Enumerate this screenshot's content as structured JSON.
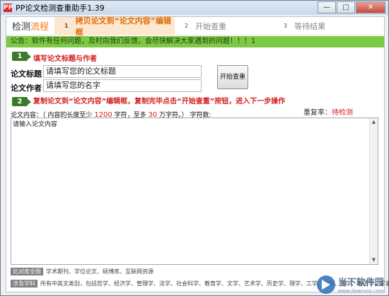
{
  "window": {
    "title": "PP论文检测查重助手1.39",
    "icon": "PP",
    "buttons": [
      "—",
      "□",
      "✕"
    ]
  },
  "steps": {
    "title_main": "检测",
    "title_accent": "流程",
    "items": [
      {
        "num": "1",
        "label": "拷贝论文到“论文内容”编辑框"
      },
      {
        "num": "2",
        "label": "开始查重"
      },
      {
        "num": "3",
        "label": "等待结果"
      }
    ]
  },
  "notice": "公告：软件有任何问题，及时向我们反馈，会尽快解决大家遇到的问题！！！1",
  "section1": {
    "badge": "1",
    "label": "填写论文标题与作者"
  },
  "fields": {
    "title_label": "论文标题：",
    "title_value": "请填写您的论文标题",
    "author_label": "论文作者：",
    "author_value": "请填写您的名字"
  },
  "start_button": "开始查重",
  "section2": {
    "badge": "2",
    "label": "复制论文到“论文内容”编辑框，复制完毕点击“开始查重”按钮，进入下一步操作"
  },
  "content": {
    "hint_prefix": "论文内容：（ 内容的长度至少",
    "min": "1200",
    "hint_mid": "字符，至多",
    "max": "30",
    "hint_suffix": "万字符。）  字符数:",
    "placeholder": "请输入论文内容"
  },
  "repeat": {
    "label": "重复率：",
    "value": "待检测"
  },
  "databases": [
    {
      "tag": "比对库全国",
      "text": "学术期刊、学位论文、硕博库、互联网资源"
    },
    {
      "tag": "涉及学科",
      "text": "所有中英文类别，包括哲学、经济学、管理学、法学、社会科学、教育学、文学、艺术学、历史学、理学、工学、农学、医学、政治学、军事学..."
    }
  ],
  "watermark": {
    "cn": "当下软件园",
    "en": "www.downxia.com"
  },
  "colors": {
    "accent": "#f07b1e",
    "notice_bg": "#7dc845",
    "red": "#d42020"
  }
}
